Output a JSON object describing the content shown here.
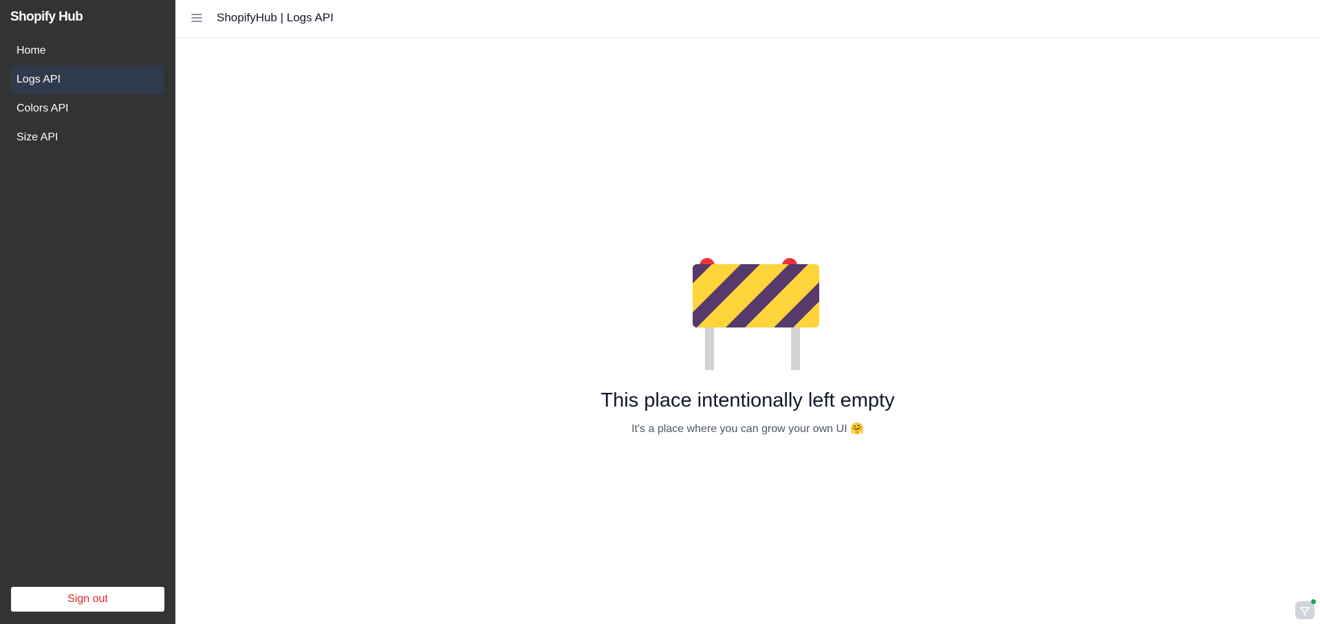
{
  "sidebar": {
    "brand": "Shopify Hub",
    "items": [
      {
        "label": "Home"
      },
      {
        "label": "Logs API"
      },
      {
        "label": "Colors API"
      },
      {
        "label": "Size API"
      }
    ],
    "active_index": 1,
    "signout_label": "Sign out"
  },
  "header": {
    "title": "ShopifyHub | Logs API",
    "menu_icon": "hamburger-menu-icon"
  },
  "main": {
    "illustration_icon": "road-barrier-icon",
    "title": "This place intentionally left empty",
    "subtitle": "It's a place where you can grow your own UI 🤗"
  },
  "colors": {
    "sidebar_bg": "#333333",
    "active_item_bg": "#2f3b4c",
    "signout_text": "#e02424",
    "barrier_yellow": "#fdd43a",
    "barrier_purple": "#553a6b",
    "barrier_light": "#f0303a",
    "barrier_post": "#d3d3d3"
  }
}
